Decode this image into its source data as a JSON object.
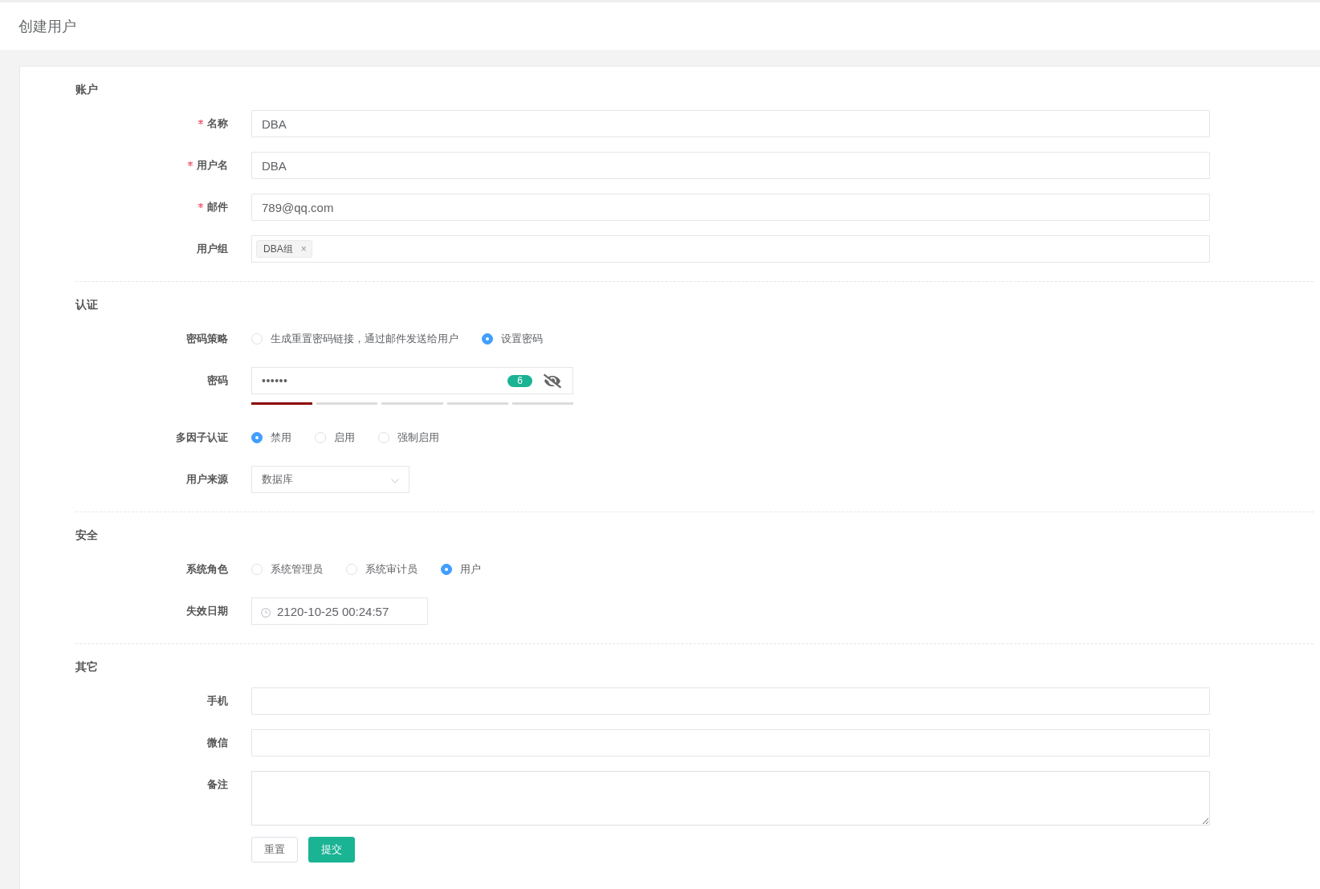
{
  "header": {
    "title": "创建用户"
  },
  "sections": [
    {
      "title": "账户",
      "fields": [
        {
          "kind": "text",
          "label": "名称",
          "required": true,
          "value": "DBA"
        },
        {
          "kind": "text",
          "label": "用户名",
          "required": true,
          "value": "DBA"
        },
        {
          "kind": "text",
          "label": "邮件",
          "required": true,
          "value": "789@qq.com"
        },
        {
          "kind": "tags",
          "label": "用户组",
          "required": false,
          "tags": [
            {
              "text": "DBA组",
              "remove": "×"
            }
          ]
        }
      ]
    },
    {
      "title": "认证",
      "fields": [
        {
          "kind": "radio",
          "label": "密码策略",
          "required": false,
          "options": [
            {
              "label": "生成重置密码链接，通过邮件发送给用户",
              "selected": false
            },
            {
              "label": "设置密码",
              "selected": true
            }
          ]
        },
        {
          "kind": "password",
          "label": "密码",
          "required": false,
          "value": "••••••",
          "count": "6",
          "visible": false,
          "strength": {
            "level": 0.2
          }
        },
        {
          "kind": "radio",
          "label": "多因子认证",
          "required": false,
          "options": [
            {
              "label": "禁用",
              "selected": true
            },
            {
              "label": "启用",
              "selected": false
            },
            {
              "label": "强制启用",
              "selected": false
            }
          ]
        },
        {
          "kind": "select",
          "label": "用户来源",
          "required": false,
          "value": "数据库"
        }
      ]
    },
    {
      "title": "安全",
      "fields": [
        {
          "kind": "radio",
          "label": "系统角色",
          "required": false,
          "options": [
            {
              "label": "系统管理员",
              "selected": false
            },
            {
              "label": "系统审计员",
              "selected": false
            },
            {
              "label": "用户",
              "selected": true
            }
          ]
        },
        {
          "kind": "datetime",
          "label": "失效日期",
          "required": false,
          "value": "2120-10-25 00:24:57"
        }
      ]
    },
    {
      "title": "其它",
      "fields": [
        {
          "kind": "text",
          "label": "手机",
          "required": false
        },
        {
          "kind": "text",
          "label": "微信",
          "required": false
        },
        {
          "kind": "textarea",
          "label": "备注",
          "required": false
        }
      ]
    }
  ],
  "buttons": [
    {
      "kind": "reset",
      "label": "重置"
    },
    {
      "kind": "submit",
      "label": "提交"
    }
  ]
}
